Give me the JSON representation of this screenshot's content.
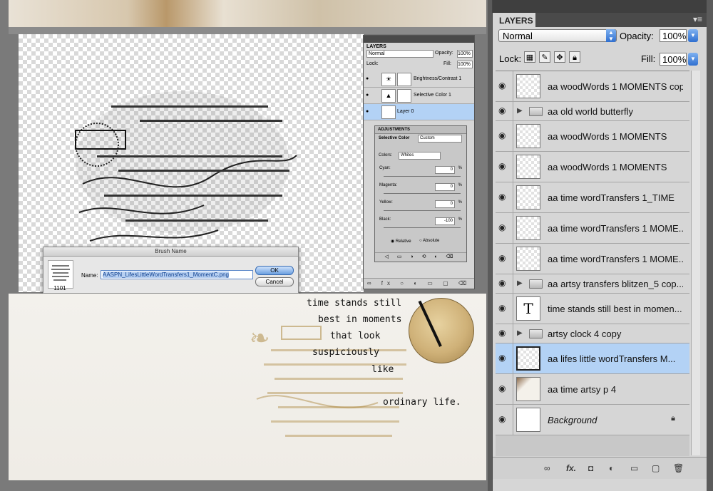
{
  "canvas": {
    "poem": [
      "time stands still",
      "best in moments",
      "that look",
      "suspiciously",
      "like",
      "ordinary life."
    ]
  },
  "mini_layers": {
    "tab": "LAYERS",
    "blend": "Normal",
    "opacity_label": "Opacity:",
    "opacity": "100%",
    "lock_label": "Lock:",
    "fill_label": "Fill:",
    "fill": "100%",
    "layers": [
      {
        "name": "Brightness/Contrast 1"
      },
      {
        "name": "Selective Color 1"
      },
      {
        "name": "Layer 0"
      }
    ]
  },
  "adjustments": {
    "tab": "ADJUSTMENTS",
    "type_label": "Selective Color",
    "preset": "Custom",
    "colors_label": "Colors:",
    "colors_value": "Whites",
    "sliders": [
      {
        "label": "Cyan:",
        "value": "0"
      },
      {
        "label": "Magenta:",
        "value": "0"
      },
      {
        "label": "Yellow:",
        "value": "0"
      },
      {
        "label": "Black:",
        "value": "-100"
      }
    ],
    "percent": "%",
    "relative": "Relative",
    "absolute": "Absolute"
  },
  "brush_dialog": {
    "title": "Brush Name",
    "name_label": "Name:",
    "name_value": "AASPN_LifesLittleWordTransfers1_MomentC.png",
    "brush_size": "1101",
    "ok": "OK",
    "cancel": "Cancel"
  },
  "layers_panel": {
    "tab": "LAYERS",
    "blend_mode": "Normal",
    "opacity_label": "Opacity:",
    "opacity": "100%",
    "lock_label": "Lock:",
    "fill_label": "Fill:",
    "fill": "100%",
    "layers": [
      {
        "name": "aa woodWords 1 MOMENTS copy",
        "kind": "layer"
      },
      {
        "name": "aa old world butterfly",
        "kind": "group"
      },
      {
        "name": "aa woodWords 1 MOMENTS",
        "kind": "layer"
      },
      {
        "name": "aa woodWords 1 MOMENTS",
        "kind": "layer"
      },
      {
        "name": "aa time wordTransfers 1_TIME",
        "kind": "layer"
      },
      {
        "name": "aa time wordTransfers 1 MOME...",
        "kind": "layer"
      },
      {
        "name": "aa time wordTransfers 1 MOME...",
        "kind": "layer"
      },
      {
        "name": "aa artsy transfers blitzen_5 cop...",
        "kind": "group"
      },
      {
        "name": "time stands still  best in momen...",
        "kind": "type",
        "thumb_text": "T"
      },
      {
        "name": "artsy clock 4 copy",
        "kind": "group"
      },
      {
        "name": "aa lifes little wordTransfers M...",
        "kind": "layer",
        "selected": true
      },
      {
        "name": "aa time artsy p 4",
        "kind": "photo"
      },
      {
        "name": "Background",
        "kind": "background"
      }
    ]
  }
}
